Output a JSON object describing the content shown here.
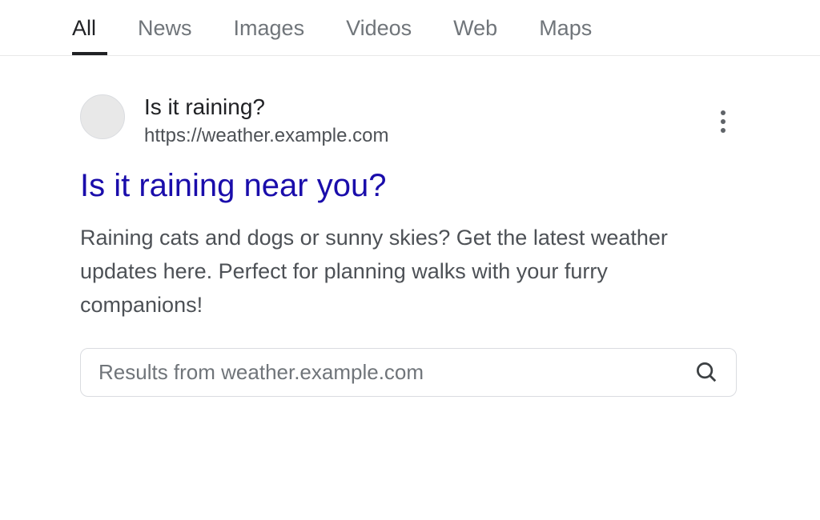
{
  "tabs": [
    {
      "label": "All",
      "active": true
    },
    {
      "label": "News",
      "active": false
    },
    {
      "label": "Images",
      "active": false
    },
    {
      "label": "Videos",
      "active": false
    },
    {
      "label": "Web",
      "active": false
    },
    {
      "label": "Maps",
      "active": false
    }
  ],
  "result": {
    "site_name": "Is it raining?",
    "site_url": "https://weather.example.com",
    "title": "Is it raining near you?",
    "description": "Raining cats and dogs or sunny skies? Get the latest weather updates here. Perfect for planning walks with your furry companions!",
    "sitelinks_placeholder": "Results from weather.example.com"
  }
}
